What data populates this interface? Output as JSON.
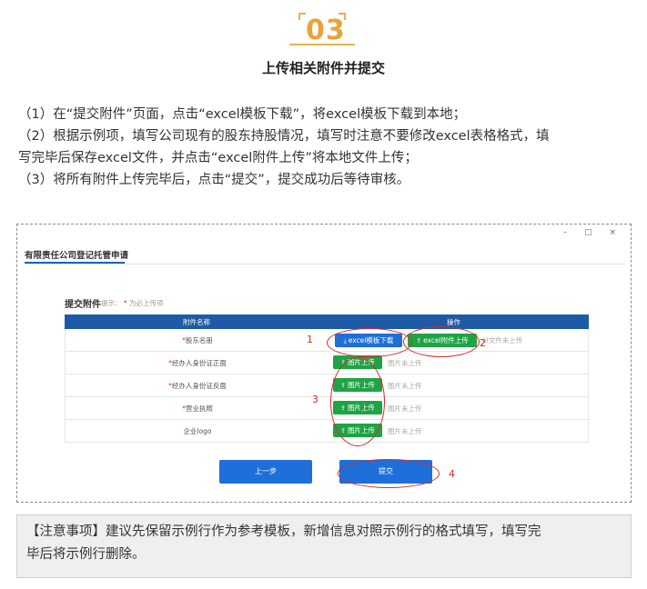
{
  "step_badge": "03",
  "heading": "上传相关附件并提交",
  "paragraphs": [
    "（1）在“提交附件”页面，点击“excel模板下载”，将excel模板下载到本地；",
    "（2）根据示例项，填写公司现有的股东持股情况，填写时注意不要修改excel表格格式，填",
    "写完毕后保存excel文件，并点击“excel附件上传”将本地文件上传；",
    "（3）将所有附件上传完毕后，点击“提交”，提交成功后等待审核。"
  ],
  "screenshot": {
    "window_controls": "–  ▢  ×",
    "tab_title": "有限责任公司登记托管申请",
    "section_title": "提交附件",
    "section_hint_prefix": "提示：",
    "section_hint_star": "*",
    "section_hint_text": "为必上传项",
    "table_headers": [
      "附件名称",
      "操作"
    ],
    "rows": [
      {
        "star": "*",
        "name": "股东名册",
        "btn1": "excel模板下载",
        "btn2": "excel附件上传",
        "status": "el文件未上传"
      },
      {
        "star": "*",
        "name": "经办人身份证正面",
        "btn1": "图片上传",
        "status": "图片未上传"
      },
      {
        "star": "*",
        "name": "经办人身份证反面",
        "btn1": "图片上传",
        "status": "图片未上传"
      },
      {
        "star": "*",
        "name": "营业执照",
        "btn1": "图片上传",
        "status": "图片未上传"
      },
      {
        "star": "",
        "name": "企业logo",
        "btn1": "图片上传",
        "status": "图片未上传"
      }
    ],
    "prev_button": "上一步",
    "submit_button": "提交",
    "markers": [
      "1",
      "2",
      "3",
      "4"
    ],
    "icons": {
      "download": "download-icon",
      "upload": "upload-icon"
    },
    "colors": {
      "header": "#1e5aa5",
      "blue_button": "#1e6fd9",
      "green_button": "#1fa345",
      "annotation": "#d62a2a"
    }
  },
  "note": {
    "line1": "【注意事项】建议先保留示例行作为参考模板，新增信息对照示例行的格式填写，填写完",
    "line2": "毕后将示例行删除。"
  }
}
